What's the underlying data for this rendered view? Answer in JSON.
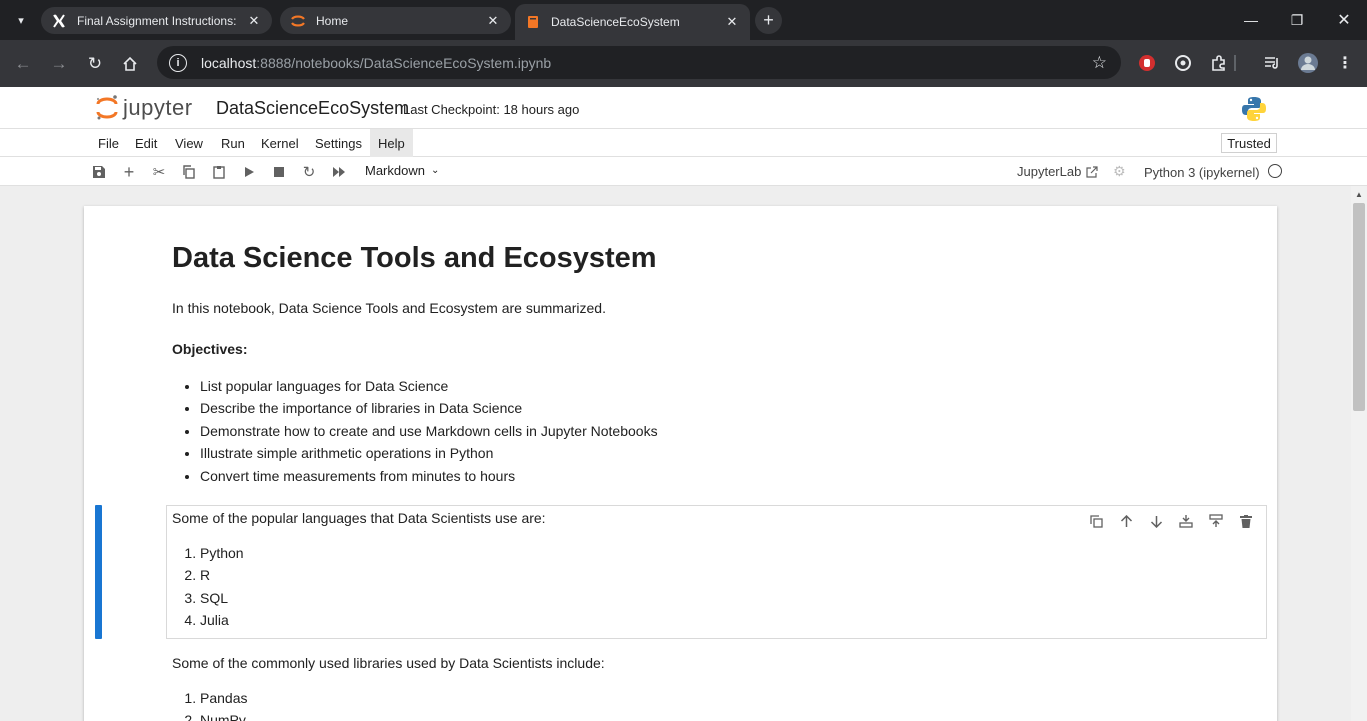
{
  "browser": {
    "tabs": [
      {
        "title": "Final Assignment Instructions: C",
        "icon": "x-logo-icon"
      },
      {
        "title": "Home",
        "icon": "jupyter-icon"
      },
      {
        "title": "DataScienceEcoSystem",
        "icon": "notebook-icon"
      }
    ],
    "url_host": "localhost",
    "url_rest": ":8888/notebooks/DataScienceEcoSystem.ipynb"
  },
  "jupyter": {
    "logo_text": "jupyter",
    "notebook_name": "DataScienceEcoSystem",
    "checkpoint": "Last Checkpoint: 18 hours ago",
    "menu": [
      "File",
      "Edit",
      "View",
      "Run",
      "Kernel",
      "Settings",
      "Help"
    ],
    "trusted": "Trusted",
    "cell_type": "Markdown",
    "jupyterlab_link": "JupyterLab",
    "kernel": "Python 3 (ipykernel)"
  },
  "notebook": {
    "heading": "Data Science Tools and Ecosystem",
    "intro": "In this notebook, Data Science Tools and Ecosystem are summarized.",
    "objectives_label": "Objectives:",
    "objectives": [
      "List popular languages for Data Science",
      "Describe the importance of libraries in Data Science",
      "Demonstrate how to create and use Markdown cells in Jupyter Notebooks",
      "Illustrate simple arithmetic operations in Python",
      "Convert time measurements from minutes to hours"
    ],
    "languages_intro": "Some of the popular languages that Data Scientists use are:",
    "languages": [
      "Python",
      "R",
      "SQL",
      "Julia"
    ],
    "libraries_intro": "Some of the commonly used libraries used by Data Scientists include:",
    "libraries": [
      "Pandas",
      "NumPy"
    ]
  },
  "colors": {
    "accent": "#1976d2",
    "chrome_dark": "#202124",
    "chrome_mid": "#35363a"
  }
}
